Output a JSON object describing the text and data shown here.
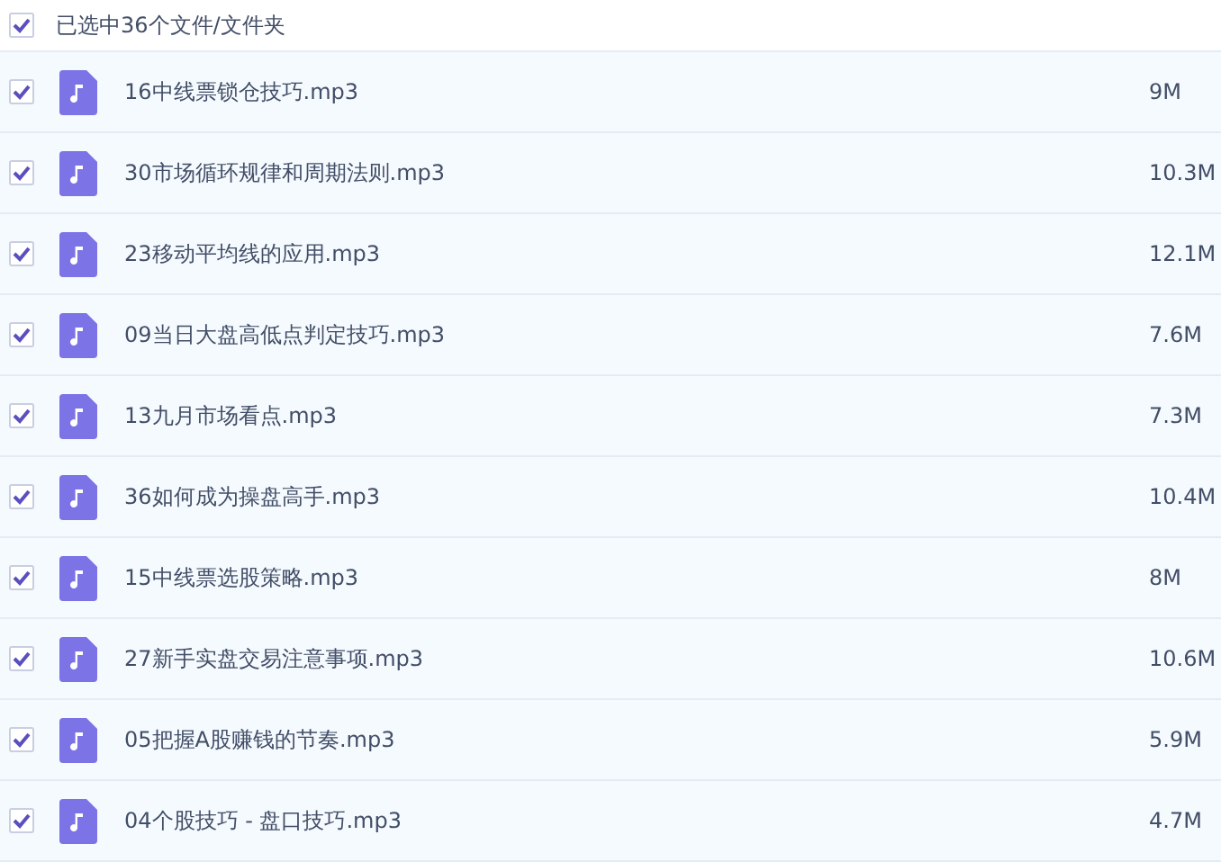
{
  "header": {
    "checked": true,
    "label": "已选中36个文件/文件夹"
  },
  "files": [
    {
      "name": "16中线票锁仓技巧.mp3",
      "size": "9M",
      "checked": true
    },
    {
      "name": "30市场循环规律和周期法则.mp3",
      "size": "10.3M",
      "checked": true
    },
    {
      "name": "23移动平均线的应用.mp3",
      "size": "12.1M",
      "checked": true
    },
    {
      "name": "09当日大盘高低点判定技巧.mp3",
      "size": "7.6M",
      "checked": true
    },
    {
      "name": "13九月市场看点.mp3",
      "size": "7.3M",
      "checked": true
    },
    {
      "name": "36如何成为操盘高手.mp3",
      "size": "10.4M",
      "checked": true
    },
    {
      "name": "15中线票选股策略.mp3",
      "size": "8M",
      "checked": true
    },
    {
      "name": "27新手实盘交易注意事项.mp3",
      "size": "10.6M",
      "checked": true
    },
    {
      "name": "05把握A股赚钱的节奏.mp3",
      "size": "5.9M",
      "checked": true
    },
    {
      "name": "04个股技巧 - 盘口技巧.mp3",
      "size": "4.7M",
      "checked": true
    }
  ]
}
